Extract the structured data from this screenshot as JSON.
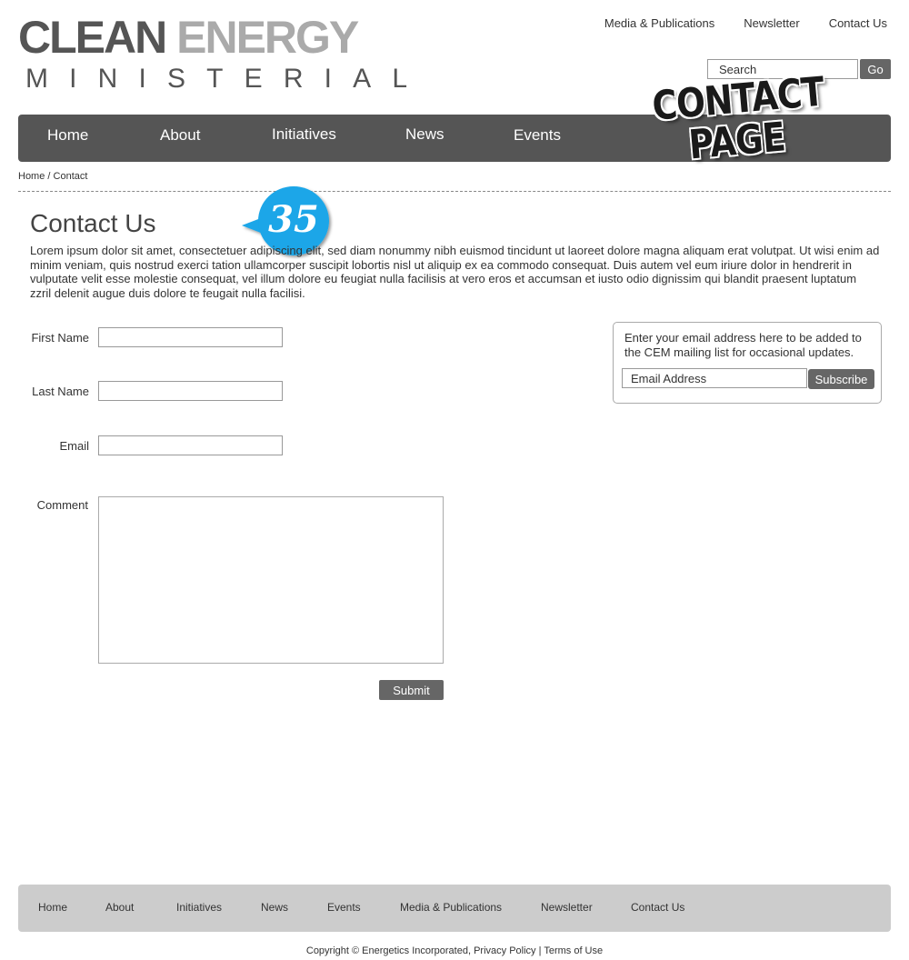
{
  "logo": {
    "word1": "CLEAN",
    "word2": "ENERGY",
    "letters": [
      "M",
      "I",
      "N",
      "I",
      "S",
      "T",
      "E",
      "R",
      "I",
      "A",
      "L"
    ]
  },
  "top_links": [
    "Media & Publications",
    "Newsletter",
    "Contact Us"
  ],
  "search": {
    "value": "Search",
    "button": "Go"
  },
  "main_nav": [
    "Home",
    "About",
    "Initiatives",
    "News",
    "Events"
  ],
  "stamp": {
    "line1": "CONTACT",
    "line2": "PAGE"
  },
  "breadcrumb": {
    "home": "Home",
    "separator": " / ",
    "current": "Contact"
  },
  "annotation": {
    "number": "35",
    "color": "#1aa6e8"
  },
  "page": {
    "title": "Contact Us",
    "intro": "Lorem ipsum dolor sit amet, consectetuer adipiscing elit, sed diam nonummy nibh euismod tincidunt ut laoreet dolore magna aliquam erat volutpat. Ut wisi enim ad minim veniam, quis nostrud exerci tation ullamcorper suscipit lobortis nisl ut aliquip ex ea commodo consequat. Duis autem vel eum iriure dolor in hendrerit in vulputate velit esse molestie consequat, vel illum dolore eu feugiat nulla facilisis at vero eros et accumsan et iusto odio dignissim qui blandit praesent luptatum zzril delenit augue duis dolore te feugait nulla facilisi."
  },
  "form": {
    "first_name": "First Name",
    "last_name": "Last Name",
    "email": "Email",
    "comment": "Comment",
    "submit": "Submit"
  },
  "newsletter": {
    "text": "Enter your email address here to be added to the CEM mailing list for occasional updates.",
    "input_value": "Email Address",
    "button": "Subscribe"
  },
  "footer_nav": [
    "Home",
    "About",
    "Initiatives",
    "News",
    "Events",
    "Media & Publications",
    "Newsletter",
    "Contact Us"
  ],
  "footer": {
    "copyright": "Copyright © Energetics Incorporated,",
    "privacy": "Privacy Policy",
    "pipe": "|",
    "terms": "Terms of Use"
  },
  "colors": {
    "nav_bg": "#555555",
    "footer_bg": "#cccccc",
    "button_bg": "#666666"
  }
}
